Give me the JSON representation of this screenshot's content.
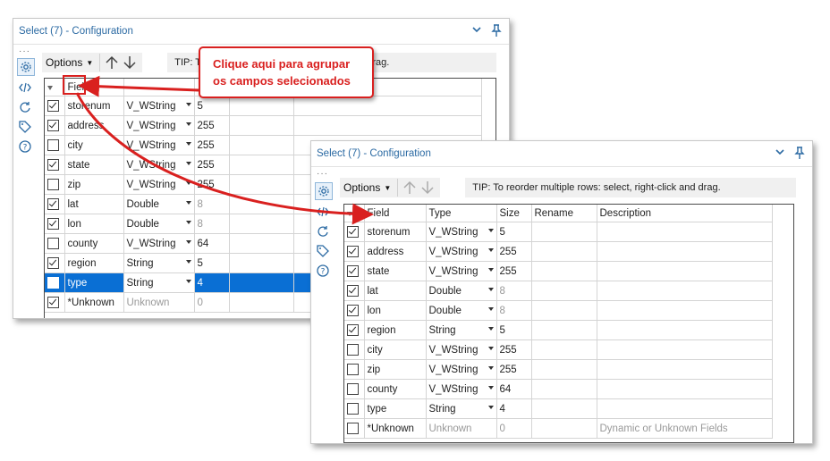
{
  "panel1": {
    "title": "Select (7) - Configuration",
    "options_label": "Options",
    "tip": "TIP: T",
    "tip_tail": "d drag.",
    "header": {
      "field": "Field"
    },
    "rows": [
      {
        "checked": true,
        "field": "storenum",
        "type": "V_WString",
        "size": "5",
        "size_gray": false
      },
      {
        "checked": true,
        "field": "address",
        "type": "V_WString",
        "size": "255",
        "size_gray": false
      },
      {
        "checked": false,
        "field": "city",
        "type": "V_WString",
        "size": "255",
        "size_gray": false
      },
      {
        "checked": true,
        "field": "state",
        "type": "V_WString",
        "size": "255",
        "size_gray": false
      },
      {
        "checked": false,
        "field": "zip",
        "type": "V_WString",
        "size": "255",
        "size_gray": false
      },
      {
        "checked": true,
        "field": "lat",
        "type": "Double",
        "size": "8",
        "size_gray": true
      },
      {
        "checked": true,
        "field": "lon",
        "type": "Double",
        "size": "8",
        "size_gray": true
      },
      {
        "checked": false,
        "field": "county",
        "type": "V_WString",
        "size": "64",
        "size_gray": false
      },
      {
        "checked": true,
        "field": "region",
        "type": "String",
        "size": "5",
        "size_gray": false
      },
      {
        "checked": false,
        "field": "type",
        "type": "String",
        "size": "4",
        "size_gray": false,
        "selected": true
      },
      {
        "checked": true,
        "field": "*Unknown",
        "type": "Unknown",
        "size": "0",
        "size_gray": true,
        "type_gray": true
      }
    ]
  },
  "panel2": {
    "title": "Select (7) - Configuration",
    "options_label": "Options",
    "tip": "TIP: To reorder multiple rows: select, right-click and drag.",
    "header": {
      "field": "Field",
      "type": "Type",
      "size": "Size",
      "rename": "Rename",
      "description": "Description"
    },
    "rows": [
      {
        "checked": true,
        "field": "storenum",
        "type": "V_WString",
        "size": "5",
        "size_gray": false,
        "description": ""
      },
      {
        "checked": true,
        "field": "address",
        "type": "V_WString",
        "size": "255",
        "size_gray": false,
        "description": ""
      },
      {
        "checked": true,
        "field": "state",
        "type": "V_WString",
        "size": "255",
        "size_gray": false,
        "description": ""
      },
      {
        "checked": true,
        "field": "lat",
        "type": "Double",
        "size": "8",
        "size_gray": true,
        "description": ""
      },
      {
        "checked": true,
        "field": "lon",
        "type": "Double",
        "size": "8",
        "size_gray": true,
        "description": ""
      },
      {
        "checked": true,
        "field": "region",
        "type": "String",
        "size": "5",
        "size_gray": false,
        "description": ""
      },
      {
        "checked": false,
        "field": "city",
        "type": "V_WString",
        "size": "255",
        "size_gray": false,
        "description": ""
      },
      {
        "checked": false,
        "field": "zip",
        "type": "V_WString",
        "size": "255",
        "size_gray": false,
        "description": ""
      },
      {
        "checked": false,
        "field": "county",
        "type": "V_WString",
        "size": "64",
        "size_gray": false,
        "description": ""
      },
      {
        "checked": false,
        "field": "type",
        "type": "String",
        "size": "4",
        "size_gray": false,
        "description": ""
      },
      {
        "checked": false,
        "field": "*Unknown",
        "type": "Unknown",
        "size": "0",
        "size_gray": true,
        "type_gray": true,
        "description": "Dynamic or Unknown Fields"
      }
    ]
  },
  "callout": {
    "line1": "Clique aqui para agrupar",
    "line2": "os campos selecionados"
  },
  "colors": {
    "title_blue": "#2b6aa3",
    "selected_row": "#0a6fd4",
    "annotation_red": "#d9201f"
  },
  "icons": [
    "gear-icon",
    "code-icon",
    "rotate-icon",
    "tag-icon",
    "help-icon",
    "chevron-down-icon",
    "pin-icon",
    "arrow-up-icon",
    "arrow-down-icon"
  ]
}
